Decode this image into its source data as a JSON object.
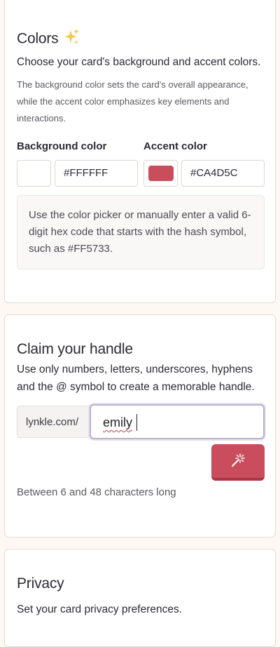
{
  "colors": {
    "title": "Colors",
    "title_icon": "sparkles-icon",
    "subtitle": "Choose your card's background and accent colors.",
    "description": "The background color sets the card's overall appearance, while the accent color emphasizes key elements and interactions.",
    "background_label": "Background color",
    "background_value": "#FFFFFF",
    "accent_label": "Accent color",
    "accent_value": "#CA4D5C",
    "hint": "Use the color picker or manually enter a valid 6-digit hex code that starts with the hash symbol, such as #FF5733."
  },
  "handle": {
    "title": "Claim your handle",
    "subtitle": "Use only numbers, letters, underscores, hyphens and the @ symbol to create a memorable handle.",
    "prefix": "lynkle.com/",
    "value": "emily",
    "generate_icon": "magic-wand-icon",
    "length_hint": "Between 6 and 48 characters long"
  },
  "privacy": {
    "title": "Privacy",
    "subtitle": "Set your card privacy preferences."
  },
  "theme": {
    "accent": "#CA4D5C",
    "page_background": "#FDF8F4"
  }
}
